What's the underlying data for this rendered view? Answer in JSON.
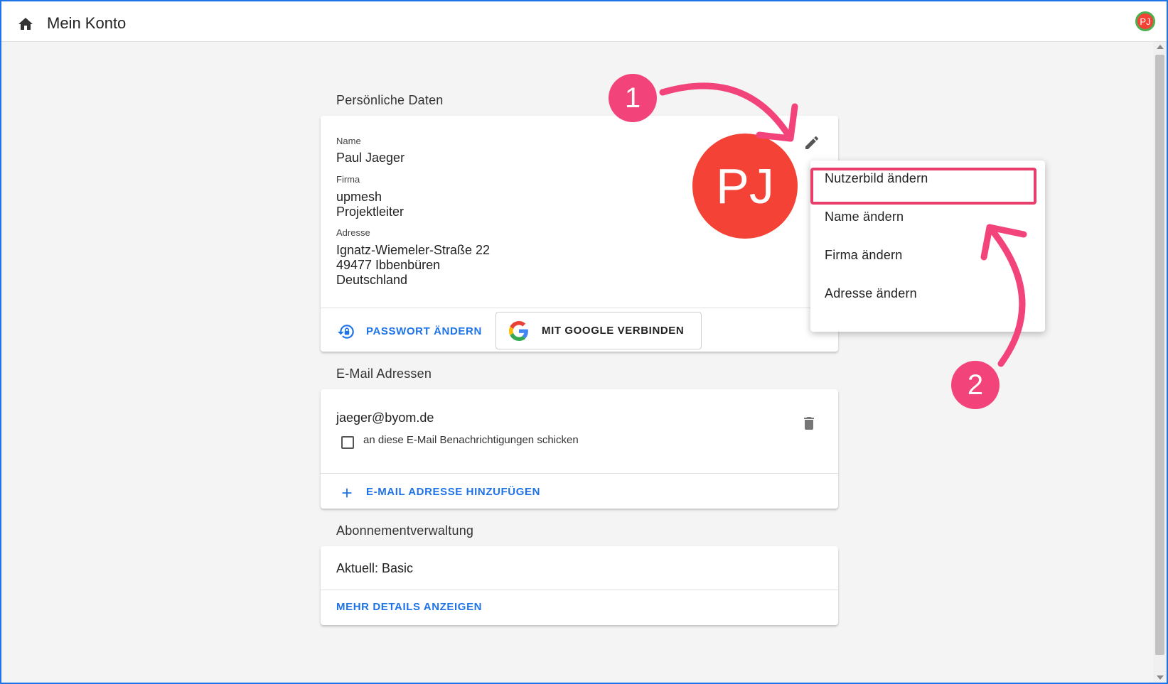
{
  "header": {
    "title": "Mein Konto",
    "avatar_initials": "PJ"
  },
  "personal": {
    "section_title": "Persönliche Daten",
    "name_label": "Name",
    "name_value": "Paul Jaeger",
    "company_label": "Firma",
    "company_line1": "upmesh",
    "company_line2": "Projektleiter",
    "address_label": "Adresse",
    "address_line1": "Ignatz-Wiemeler-Straße 22",
    "address_line2": "49477 Ibbenbüren",
    "address_line3": "Deutschland",
    "avatar_initials": "PJ",
    "password_button": "PASSWORT ÄNDERN",
    "google_button": "MIT GOOGLE VERBINDEN"
  },
  "email": {
    "section_title": "E-Mail Adressen",
    "address": "jaeger@byom.de",
    "notify_label": "an diese E-Mail Benachrichtigungen schicken",
    "notify_checked": false,
    "add_button": "E-MAIL ADRESSE HINZUFÜGEN"
  },
  "subscription": {
    "section_title": "Abonnementverwaltung",
    "current": "Aktuell: Basic",
    "details_button": "MEHR DETAILS ANZEIGEN"
  },
  "menu": {
    "items": [
      "Nutzerbild ändern",
      "Name ändern",
      "Firma ändern",
      "Adresse ändern"
    ]
  },
  "annotations": {
    "badge1": "1",
    "badge2": "2"
  },
  "colors": {
    "accent": "#1e73e8",
    "avatar": "#f44336",
    "annotation": "#f2447a"
  },
  "icons": [
    "home-icon",
    "pencil-icon",
    "lock-reset-icon",
    "google-icon",
    "trash-icon",
    "plus-icon"
  ]
}
